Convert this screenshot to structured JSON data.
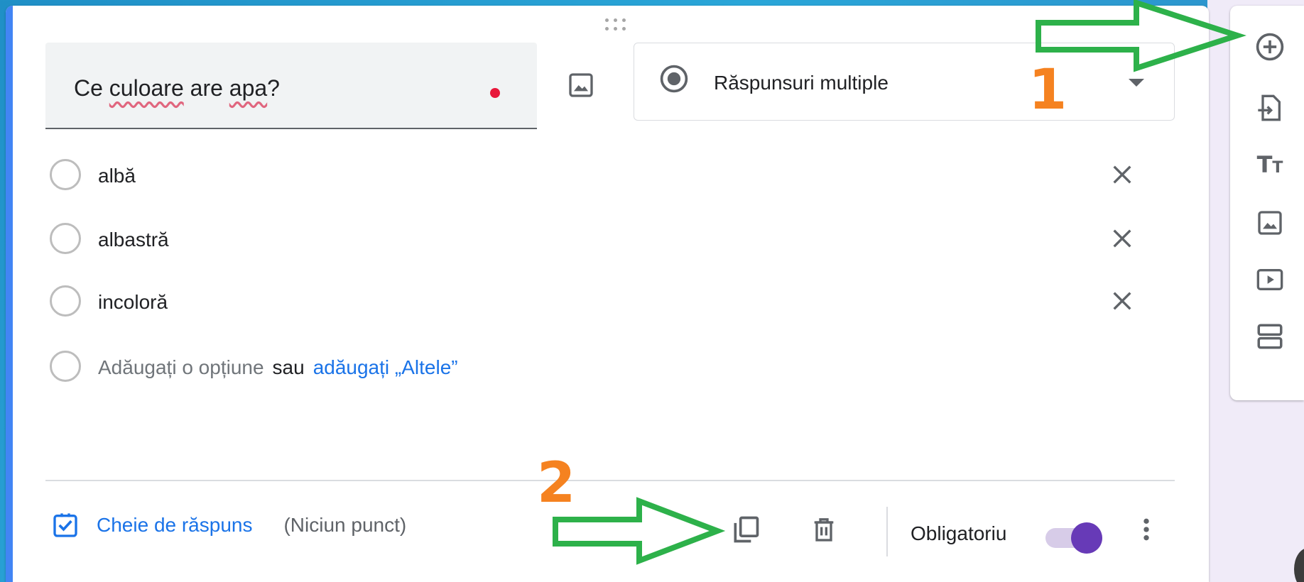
{
  "question": {
    "title_parts": [
      "Ce ",
      "culoare",
      " are ",
      "apa",
      "?"
    ],
    "type_label": "Răspunsuri multiple"
  },
  "options": [
    {
      "label": "albă"
    },
    {
      "label": "albastră"
    },
    {
      "label": "incoloră"
    }
  ],
  "add_option": {
    "placeholder": "Adăugați o opțiune",
    "or": "sau",
    "other_link": "adăugați „Altele”"
  },
  "footer": {
    "answer_key_label": "Cheie de răspuns",
    "points_label": "(Niciun punct)",
    "required_label": "Obligatoriu",
    "required_on": true
  },
  "annotations": {
    "step1": "1",
    "step2": "2",
    "arrow_color": "#2db14a",
    "number_color": "#f58220"
  },
  "colors": {
    "accent": "#4285f4",
    "link": "#1a73e8",
    "toggle": "#673ab7",
    "required_dot": "#e8173a"
  },
  "toolbar_icons": [
    "add-question-icon",
    "import-questions-icon",
    "title-text-icon",
    "image-icon",
    "video-icon",
    "section-icon"
  ]
}
